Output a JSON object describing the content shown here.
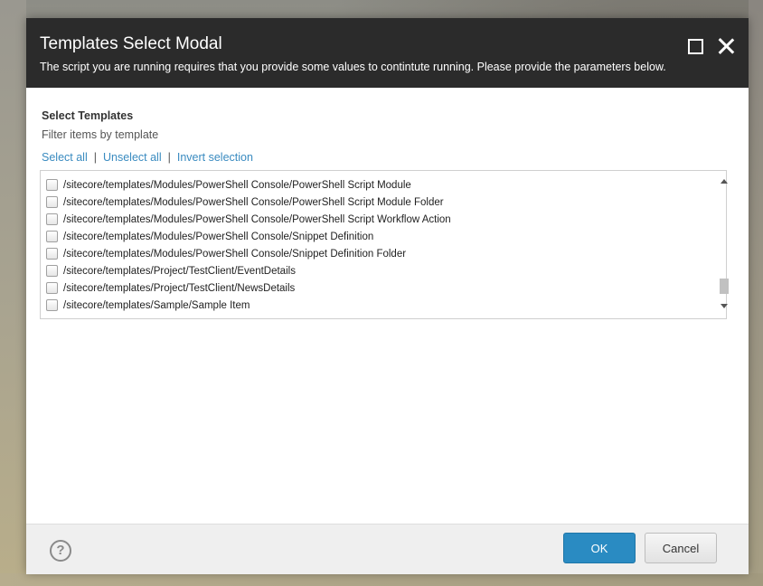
{
  "modal": {
    "title": "Templates Select Modal",
    "subtitle": "The script you are running requires that you provide some values to contintute running. Please provide the parameters below."
  },
  "field": {
    "label": "Select Templates",
    "description": "Filter items by template",
    "links": {
      "select_all": "Select all",
      "unselect_all": "Unselect all",
      "invert": "Invert selection",
      "separator": "|"
    }
  },
  "templates": [
    {
      "path": "/sitecore/templates/Modules/PowerShell Console/PowerShell Script Module",
      "checked": false
    },
    {
      "path": "/sitecore/templates/Modules/PowerShell Console/PowerShell Script Module Folder",
      "checked": false
    },
    {
      "path": "/sitecore/templates/Modules/PowerShell Console/PowerShell Script Workflow Action",
      "checked": false
    },
    {
      "path": "/sitecore/templates/Modules/PowerShell Console/Snippet Definition",
      "checked": false
    },
    {
      "path": "/sitecore/templates/Modules/PowerShell Console/Snippet Definition Folder",
      "checked": false
    },
    {
      "path": "/sitecore/templates/Project/TestClient/EventDetails",
      "checked": false
    },
    {
      "path": "/sitecore/templates/Project/TestClient/NewsDetails",
      "checked": false
    },
    {
      "path": "/sitecore/templates/Sample/Sample Item",
      "checked": false
    }
  ],
  "footer": {
    "help_icon": "question-circle-icon",
    "help_glyph": "?",
    "ok_label": "OK",
    "cancel_label": "Cancel"
  },
  "colors": {
    "header_bg": "#2b2b2b",
    "link": "#3a8bc0",
    "primary_button": "#2a8bc2"
  }
}
